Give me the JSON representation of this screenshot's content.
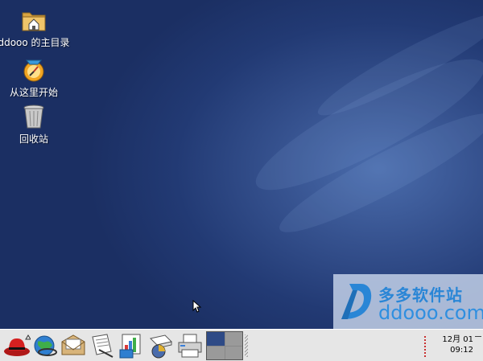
{
  "desktop": {
    "icons": [
      {
        "label": "ddooo 的主目录",
        "icon": "home-folder-icon"
      },
      {
        "label": "从这里开始",
        "icon": "start-here-icon"
      },
      {
        "label": "回收站",
        "icon": "trash-icon"
      }
    ],
    "background_colors": {
      "dark": "#1b2f63",
      "light": "#4a6cac"
    }
  },
  "watermark": {
    "line1": "多多软件站",
    "line2": "ddooo.com",
    "color": "#2a86d6"
  },
  "panel": {
    "launchers": [
      {
        "icon": "redhat-menu-icon"
      },
      {
        "icon": "web-browser-icon"
      },
      {
        "icon": "email-icon"
      },
      {
        "icon": "text-document-icon"
      },
      {
        "icon": "presentation-icon"
      },
      {
        "icon": "spreadsheet-icon"
      },
      {
        "icon": "printer-icon"
      }
    ],
    "pager": {
      "workspaces": 4,
      "active": 0
    },
    "clock": {
      "date": "12月 01",
      "time": "09:12"
    }
  }
}
